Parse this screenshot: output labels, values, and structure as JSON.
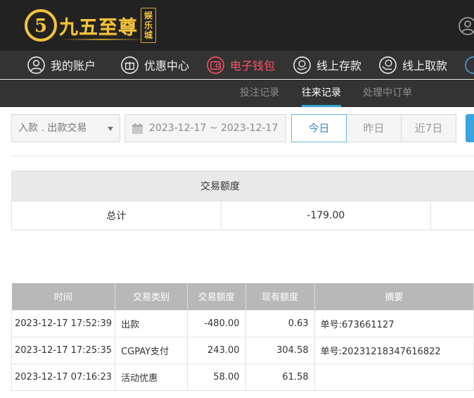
{
  "brand": {
    "mark": "5",
    "name": "九五至尊",
    "badge": [
      "娱",
      "乐",
      "城"
    ]
  },
  "main_nav": [
    {
      "label": "我的账户",
      "icon": "user-circle-icon",
      "active": false
    },
    {
      "label": "优惠中心",
      "icon": "gift-icon",
      "active": false
    },
    {
      "label": "电子钱包",
      "icon": "wallet-icon",
      "active": true
    },
    {
      "label": "线上存款",
      "icon": "deposit-icon",
      "active": false
    },
    {
      "label": "线上取款",
      "icon": "withdraw-icon",
      "active": false
    }
  ],
  "sub_nav": [
    {
      "label": "投注记录",
      "active": false
    },
    {
      "label": "往来记录",
      "active": true
    },
    {
      "label": "处理中订单",
      "active": false
    }
  ],
  "filters": {
    "type_select": "入款 . 出款交易",
    "date_range": "2023-12-17 ~ 2023-12-17",
    "quick_ranges": [
      {
        "label": "今日",
        "active": true
      },
      {
        "label": "昨日",
        "active": false
      },
      {
        "label": "近7日",
        "active": false
      }
    ]
  },
  "summary": {
    "header": "交易额度",
    "total_label": "总计",
    "total_value": "-179.00"
  },
  "records": {
    "columns": [
      "时间",
      "交易类别",
      "交易额度",
      "现有额度",
      "摘要"
    ],
    "rows": [
      [
        "2023-12-17 17:52:39",
        "出款",
        "-480.00",
        "0.63",
        "单号:673661127"
      ],
      [
        "2023-12-17 17:25:35",
        "CGPAY支付",
        "243.00",
        "304.58",
        "单号:20231218347616822"
      ],
      [
        "2023-12-17 07:16:23",
        "活动优惠",
        "58.00",
        "61.58",
        ""
      ]
    ]
  },
  "colors": {
    "header_bg": "#222222",
    "nav_bg": "#333333",
    "gold": "#f2c33f",
    "active_nav": "#ff4f6a",
    "accent_blue": "#34a7d8",
    "table_head": "#b8b8b8"
  }
}
